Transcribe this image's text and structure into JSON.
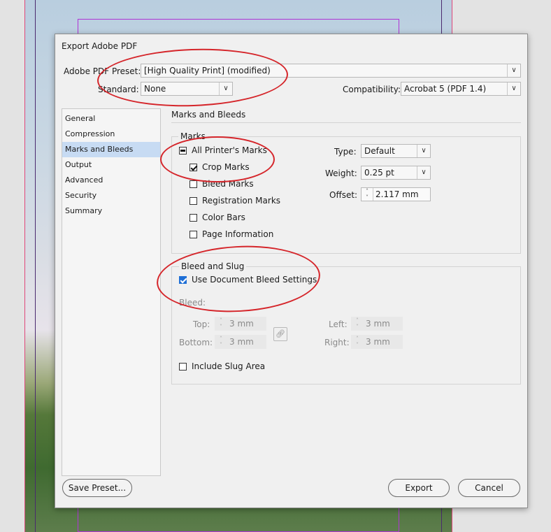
{
  "dialog": {
    "title": "Export Adobe PDF",
    "preset_label": "Adobe PDF Preset:",
    "preset_value": "[High Quality Print] (modified)",
    "standard_label": "Standard:",
    "standard_value": "None",
    "compat_label": "Compatibility:",
    "compat_value": "Acrobat 5 (PDF 1.4)"
  },
  "sidebar": {
    "items": [
      "General",
      "Compression",
      "Marks and Bleeds",
      "Output",
      "Advanced",
      "Security",
      "Summary"
    ],
    "selected": "Marks and Bleeds"
  },
  "panel": {
    "title": "Marks and Bleeds",
    "marks": {
      "legend": "Marks",
      "all_printers": "All Printer's Marks",
      "crop": "Crop Marks",
      "bleed_marks": "Bleed Marks",
      "registration": "Registration Marks",
      "color_bars": "Color Bars",
      "page_info": "Page Information",
      "type_label": "Type:",
      "type_value": "Default",
      "weight_label": "Weight:",
      "weight_value": "0.25 pt",
      "offset_label": "Offset:",
      "offset_value": "2.117 mm"
    },
    "bleed": {
      "legend": "Bleed and Slug",
      "use_doc": "Use Document Bleed Settings",
      "bleed_label": "Bleed:",
      "top_label": "Top:",
      "top_value": "3 mm",
      "bottom_label": "Bottom:",
      "bottom_value": "3 mm",
      "left_label": "Left:",
      "left_value": "3 mm",
      "right_label": "Right:",
      "right_value": "3 mm",
      "slug": "Include Slug Area"
    }
  },
  "buttons": {
    "save_preset": "Save Preset...",
    "export": "Export",
    "cancel": "Cancel"
  },
  "icons": {
    "chevron": "chevron-down-icon",
    "link": "link-icon"
  },
  "colors": {
    "selection": "#c7dbf3",
    "checkbox_blue": "#1f6fd6",
    "annotation_red": "#d5252a"
  }
}
